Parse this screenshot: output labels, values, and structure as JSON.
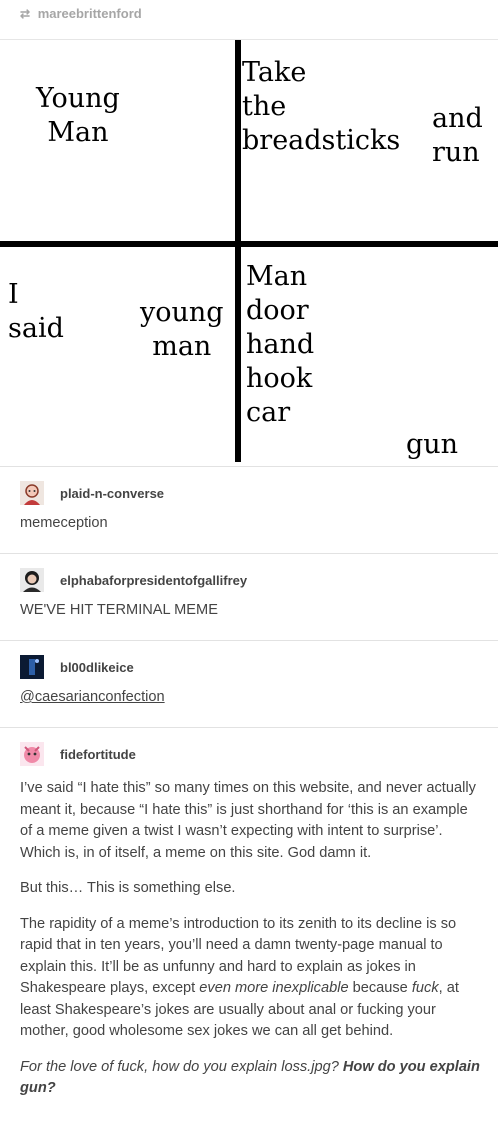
{
  "reblog": {
    "icon": "reblog-icon",
    "username": "mareebrittenford"
  },
  "comic": {
    "top_left": "Young\nMan",
    "top_right_main": "Take\nthe\nbreadsticks",
    "top_right_side": "and\nrun",
    "bottom_left_a": "I\nsaid",
    "bottom_left_b": "young\nman",
    "bottom_right_main": "Man\ndoor\nhand\nhook\ncar",
    "bottom_right_side": "gun"
  },
  "posts": [
    {
      "username": "plaid-n-converse",
      "text": "memeception"
    },
    {
      "username": "elphabaforpresidentofgallifrey",
      "text": "WE'VE HIT TERMINAL MEME"
    },
    {
      "username": "bl00dlikeice",
      "text": "@caesarianconfection"
    },
    {
      "username": "fidefortitude",
      "paragraphs": [
        "I’ve said “I hate this” so many times on this website, and never actually meant it, because “I hate this” is just shorthand for ‘this is an example of a meme given a twist I wasn’t expecting with intent to surprise’. Which is, in of itself, a meme on this site. God damn it.",
        "But this… This is something else.",
        "The rapidity of a meme’s introduction to its zenith to its decline is so rapid that in ten years, you’ll need a damn twenty-page manual to explain this. It’ll be as unfunny and hard to explain as jokes in Shakespeare plays, except ",
        "even more inexplicable",
        " because ",
        "fuck",
        ", at least Shakespeare’s jokes are usually about anal or fucking your mother, good wholesome sex jokes we can all get behind.",
        "For the love of fuck, how do you explain loss.jpg? ",
        "How do you explain gun?"
      ]
    }
  ]
}
